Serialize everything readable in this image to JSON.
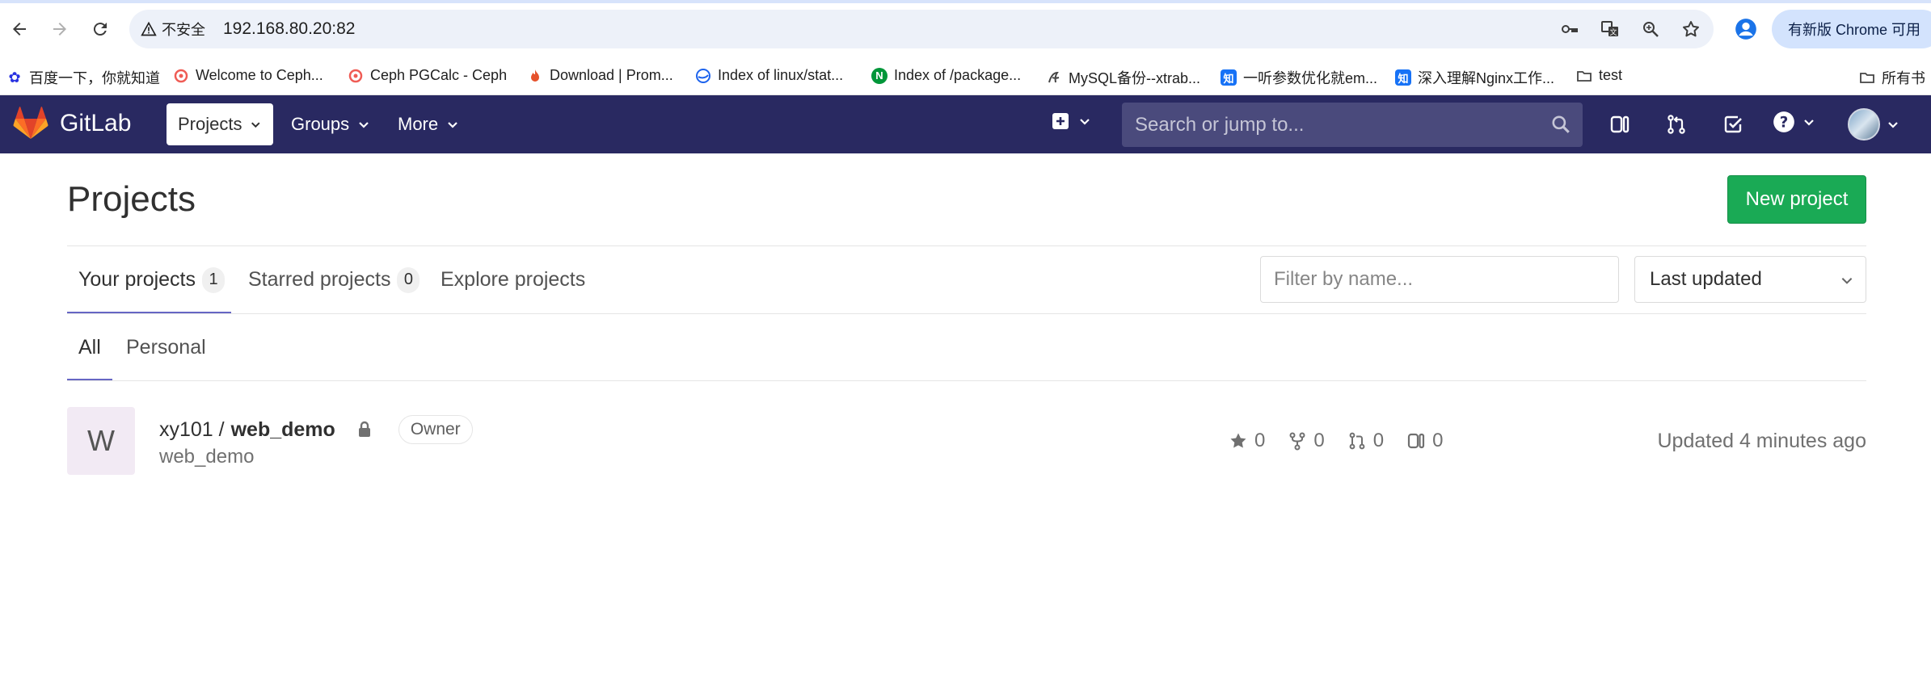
{
  "browser": {
    "security_label": "不安全",
    "url": "192.168.80.20:82",
    "update_button": "有新版 Chrome 可用",
    "bookmarks": [
      {
        "label": "百度一下，你就知道",
        "icon": "paw-icon",
        "color": "#2932e1"
      },
      {
        "label": "Welcome to Ceph...",
        "icon": "ceph-icon",
        "color": "#ef5c55"
      },
      {
        "label": "Ceph PGCalc - Ceph",
        "icon": "ceph-icon",
        "color": "#ef5c55"
      },
      {
        "label": "Download | Prom...",
        "icon": "flame-icon",
        "color": "#e6522c"
      },
      {
        "label": "Index of linux/stat...",
        "icon": "docker-icon",
        "color": "#1d63ed"
      },
      {
        "label": "Index of /package...",
        "icon": "nginx-icon",
        "color": "#009639"
      },
      {
        "label": "MySQL备份--xtrab...",
        "icon": "swirl-icon",
        "color": "#444444"
      },
      {
        "label": "一听参数优化就em...",
        "icon": "zhihu-icon",
        "color": "#1772f6"
      },
      {
        "label": "深入理解Nginx工作...",
        "icon": "zhihu-icon",
        "color": "#1772f6"
      },
      {
        "label": "test",
        "icon": "folder-icon",
        "color": "#444444"
      },
      {
        "label": "所有书",
        "icon": "folder-icon",
        "color": "#444444"
      }
    ]
  },
  "gitlab_nav": {
    "brand": "GitLab",
    "menus": [
      "Projects",
      "Groups",
      "More"
    ],
    "search_placeholder": "Search or jump to..."
  },
  "page": {
    "title": "Projects",
    "new_project_button": "New project",
    "tabs": [
      {
        "label": "Your projects",
        "count": "1"
      },
      {
        "label": "Starred projects",
        "count": "0"
      },
      {
        "label": "Explore projects"
      }
    ],
    "filter_placeholder": "Filter by name...",
    "sort_selected": "Last updated",
    "subtabs": [
      "All",
      "Personal"
    ]
  },
  "projects": [
    {
      "avatar_letter": "W",
      "namespace": "xy101 /",
      "name": "web_demo",
      "role": "Owner",
      "description": "web_demo",
      "stars": "0",
      "forks": "0",
      "merge_requests": "0",
      "issues": "0",
      "updated": "Updated 4 minutes ago"
    }
  ],
  "colors": {
    "navbar": "#292961",
    "primary_button": "#1aaa55",
    "tab_underline": "#6666c4"
  }
}
